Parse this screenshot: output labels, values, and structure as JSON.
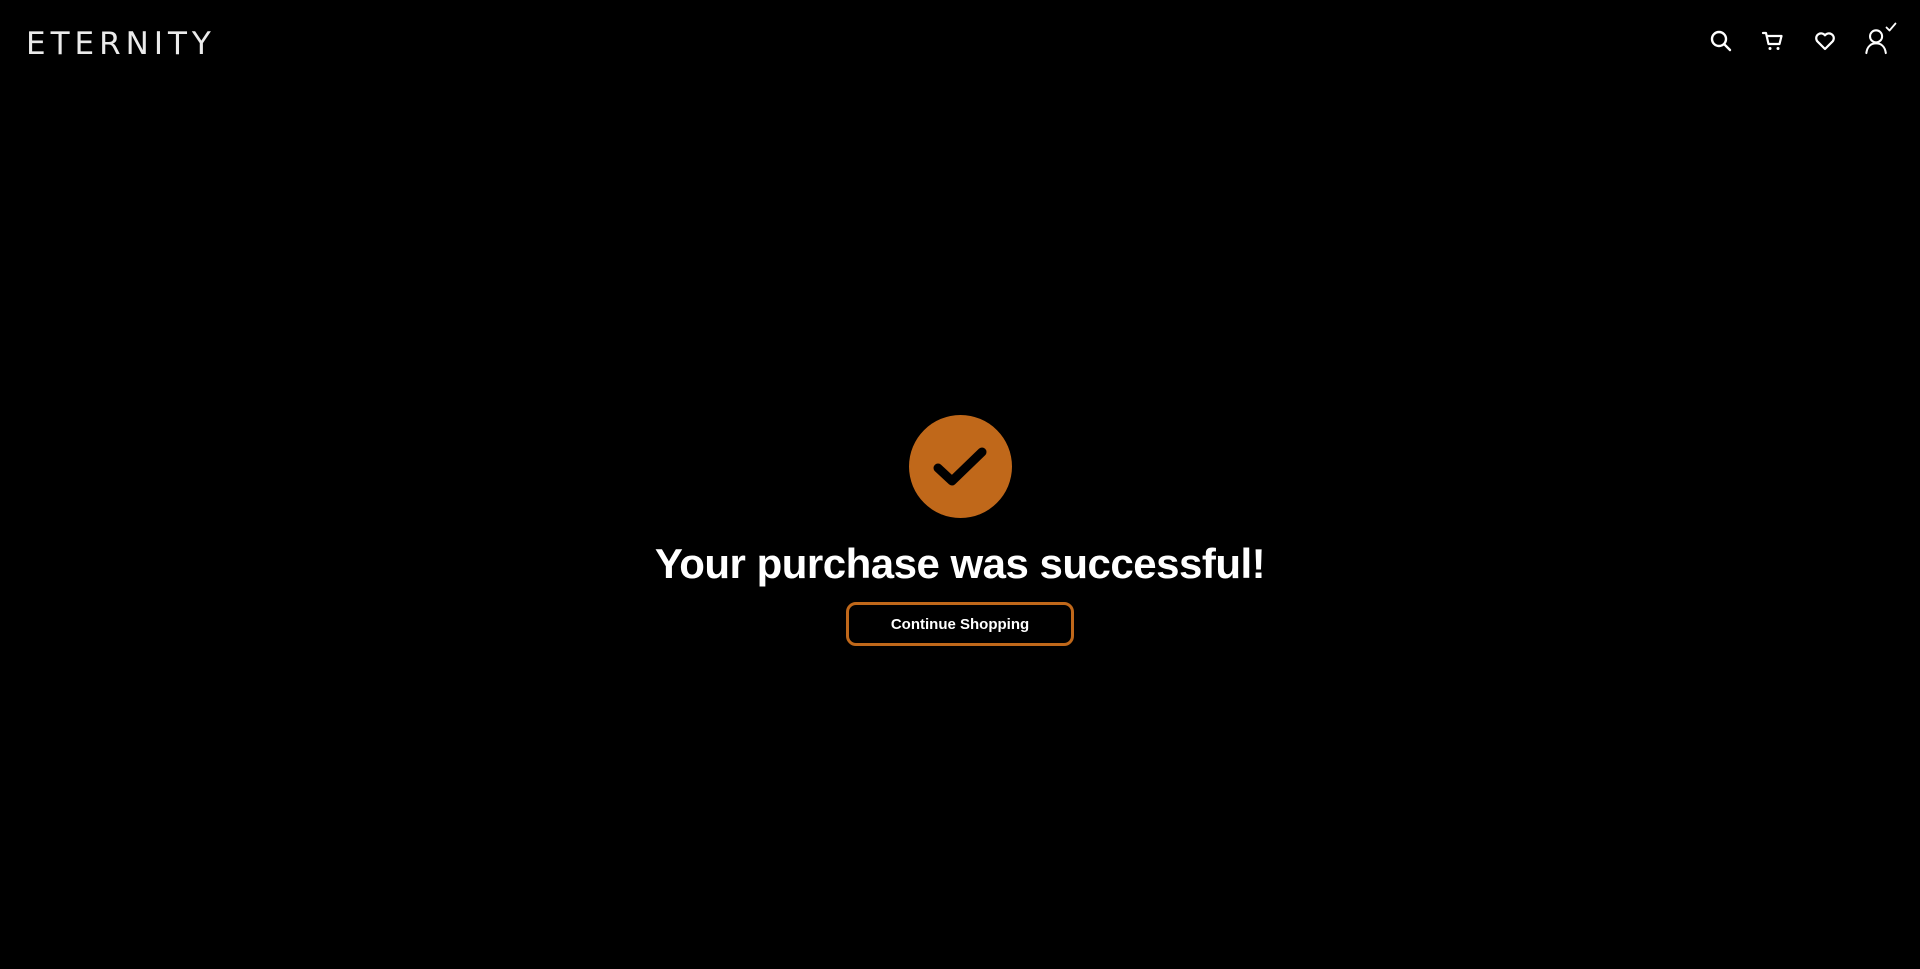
{
  "header": {
    "logo": "ETERNITY",
    "icons": [
      "search-icon",
      "cart-icon",
      "heart-icon",
      "account-icon",
      "check-icon"
    ]
  },
  "main": {
    "headline": "Your purchase was successful!",
    "continue_label": "Continue Shopping",
    "badge_icon": "check-icon"
  },
  "colors": {
    "background": "#000000",
    "accent": "#c0681a",
    "text": "#ffffff"
  }
}
